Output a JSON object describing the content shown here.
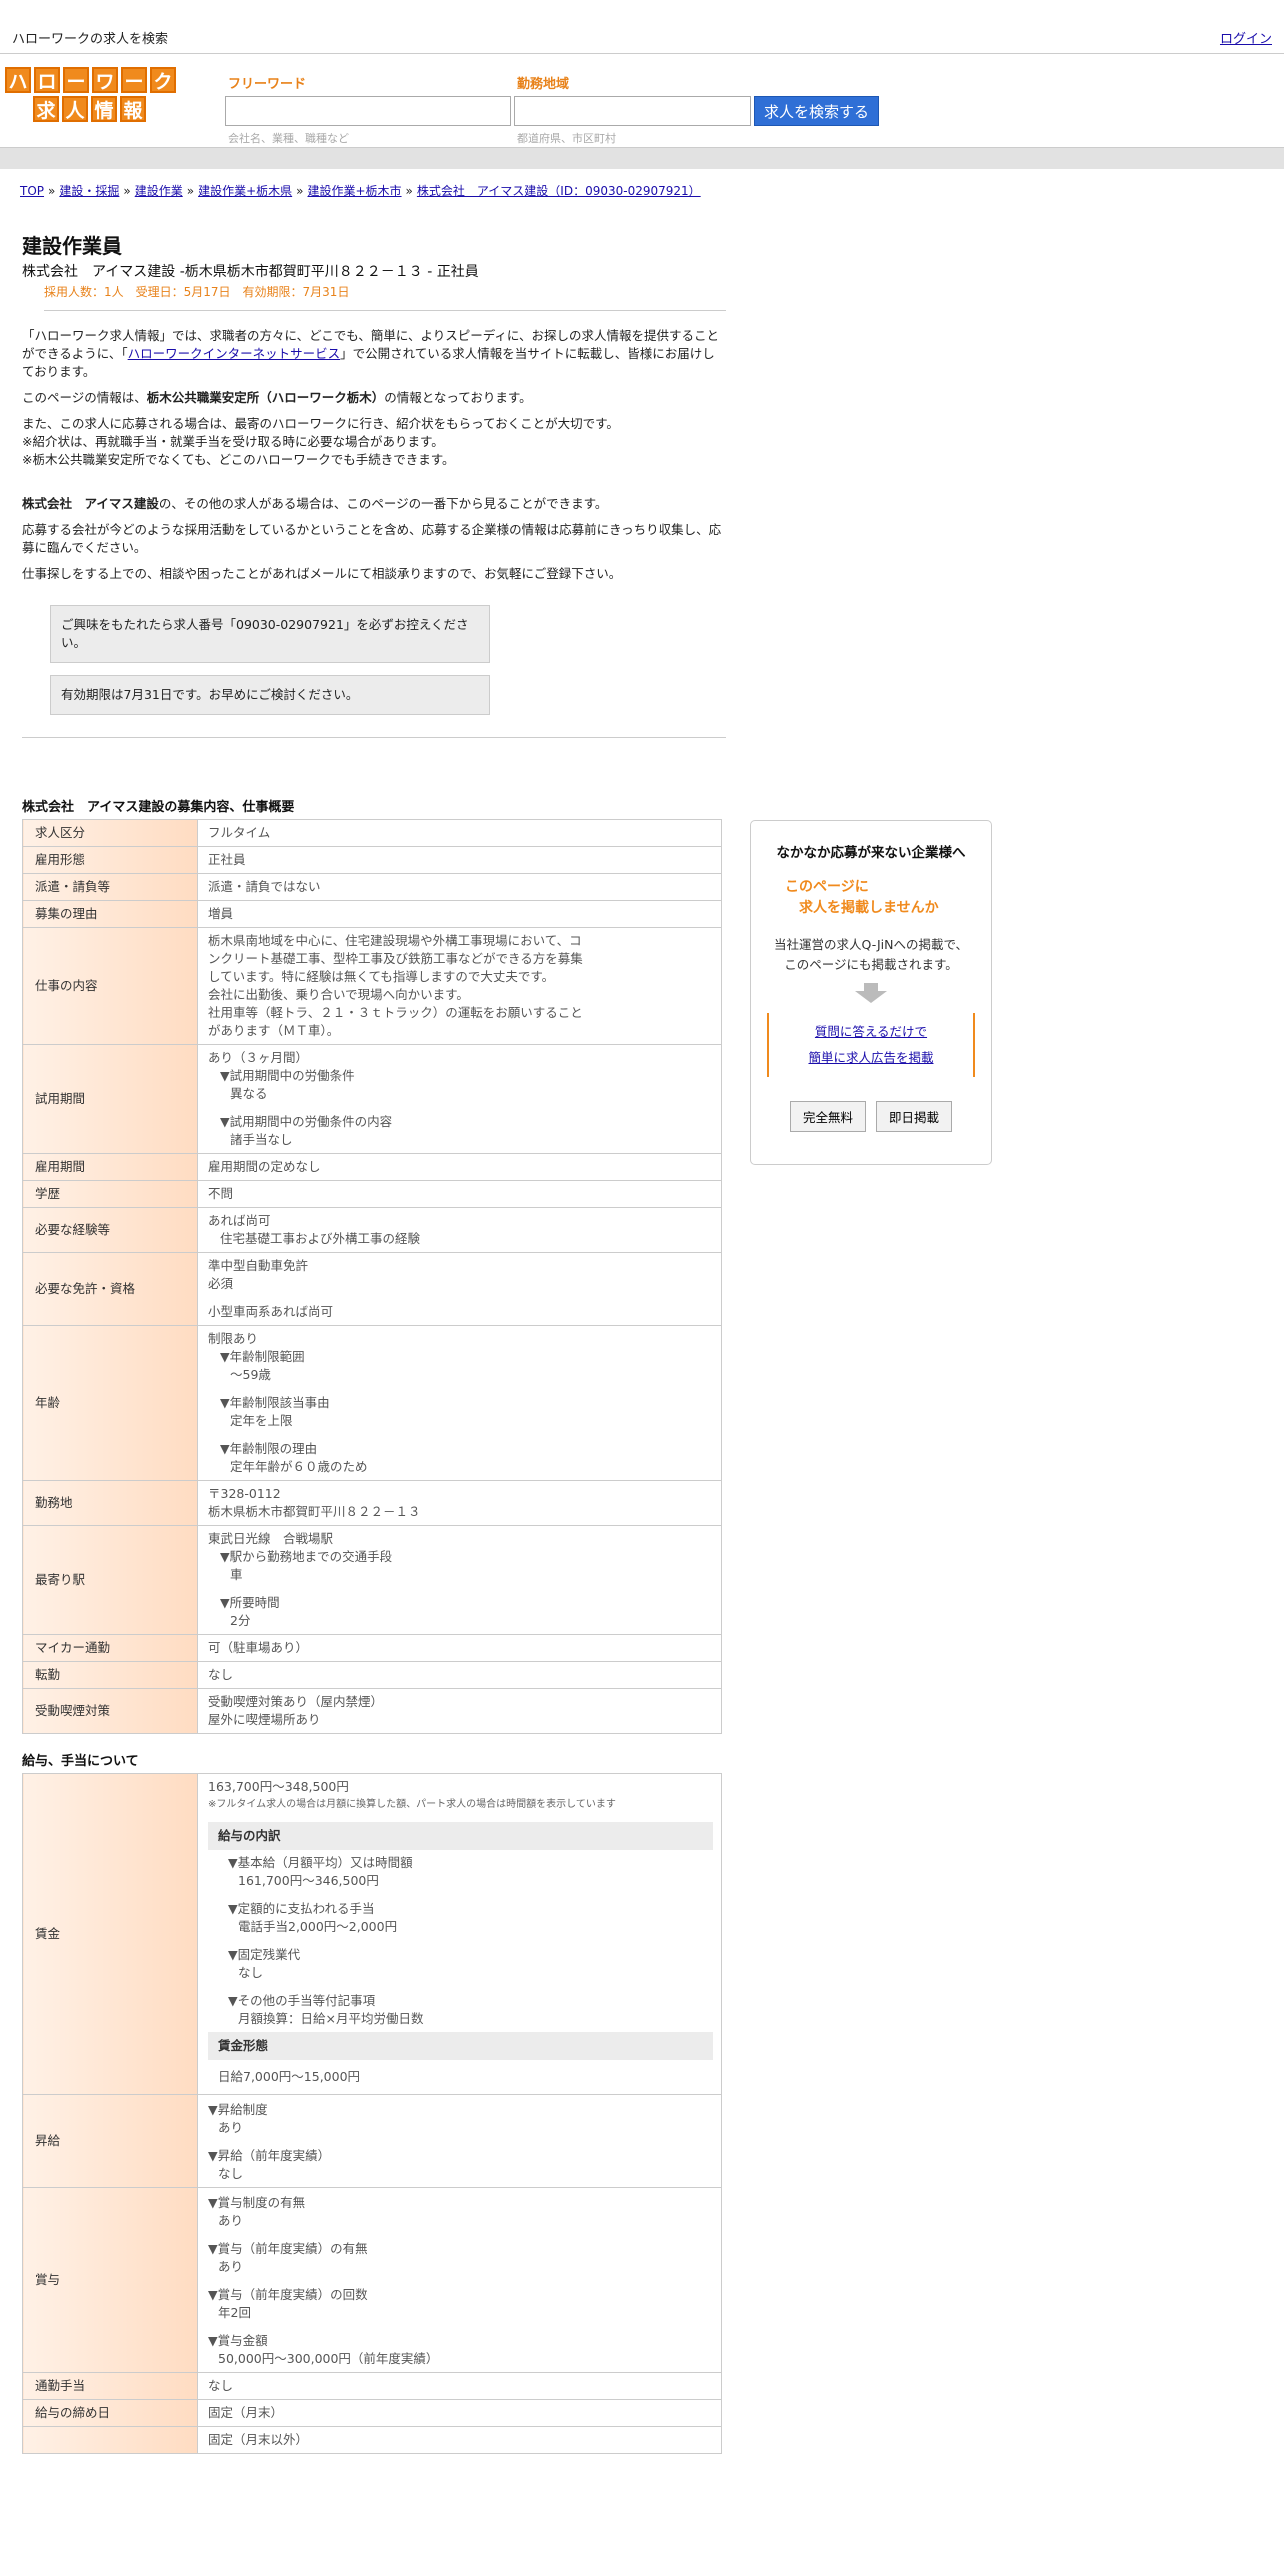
{
  "topbar": {
    "title": "ハローワークの求人を検索",
    "login": "ログイン"
  },
  "logo": {
    "row1": [
      "ハ",
      "ロ",
      "ー",
      "ワ",
      "ー",
      "ク"
    ],
    "row2": [
      "求",
      "人",
      "情",
      "報"
    ]
  },
  "search": {
    "freeword_label": "フリーワード",
    "freeword_hint": "会社名、業種、職種など",
    "area_label": "勤務地域",
    "area_hint": "都道府県、市区町村",
    "button": "求人を検索する"
  },
  "breadcrumb": [
    "TOP",
    "建設・採掘",
    "建設作業",
    "建設作業+栃木県",
    "建設作業+栃木市",
    "株式会社　アイマス建設（ID：09030-02907921）"
  ],
  "job": {
    "title": "建設作業員",
    "company_line": "株式会社　アイマス建設 -栃木県栃木市都賀町平川８２２－１３ - 正社員",
    "recruit_info": "採用人数：1人　受理日：5月17日　有効期限：7月31日"
  },
  "intro": {
    "p1_a": "「ハローワーク求人情報」では、求職者の方々に、どこでも、簡単に、よりスピーディに、お探しの求人情報を提供することができるように、「",
    "p1_link": "ハローワークインターネットサービス",
    "p1_b": "」で公開されている求人情報を当サイトに転載し、皆様にお届けしております。",
    "p2_a": "このページの情報は、",
    "p2_bold": "栃木公共職業安定所（ハローワーク栃木）",
    "p2_b": "の情報となっております。",
    "p3_1": "また、この求人に応募される場合は、最寄のハローワークに行き、紹介状をもらっておくことが大切です。",
    "p3_2": "※紹介状は、再就職手当・就業手当を受け取る時に必要な場合があります。",
    "p3_3": "※栃木公共職業安定所でなくても、どこのハローワークでも手続きできます。",
    "p4_bold": "株式会社　アイマス建設",
    "p4_b": "の、その他の求人がある場合は、このページの一番下から見ることができます。",
    "p5": "応募する会社が今どのような採用活動をしているかということを含め、応募する企業様の情報は応募前にきっちり収集し、応募に臨んでください。",
    "p6": "仕事探しをする上での、相談や困ったことがあればメールにて相談承りますので、お気軽にご登録下さい。",
    "notice1": "ご興味をもたれたら求人番号「09030-02907921」を必ずお控えください。",
    "notice2": "有効期限は7月31日です。お早めにご検討ください。"
  },
  "overview": {
    "title": "株式会社　アイマス建設の募集内容、仕事概要",
    "rows": [
      {
        "k": "求人区分",
        "v": [
          "フルタイム"
        ]
      },
      {
        "k": "雇用形態",
        "v": [
          "正社員"
        ]
      },
      {
        "k": "派遣・請負等",
        "v": [
          "派遣・請負ではない"
        ]
      },
      {
        "k": "募集の理由",
        "v": [
          "増員"
        ]
      },
      {
        "k": "仕事の内容",
        "v": [
          "栃木県南地域を中心に、住宅建設現場や外構工事現場において、コ",
          "ンクリート基礎工事、型枠工事及び鉄筋工事などができる方を募集",
          "しています。特に経験は無くても指導しますので大丈夫です。",
          "会社に出勤後、乗り合いで現場へ向かいます。",
          "社用車等（軽トラ、２１・３ｔトラック）の運転をお願いすること",
          "があります（ＭＴ車）。"
        ]
      },
      {
        "k": "試用期間",
        "v": [
          "あり（３ヶ月間）",
          "▼試用期間中の労働条件",
          "異なる",
          "",
          "▼試用期間中の労働条件の内容",
          "諸手当なし"
        ]
      },
      {
        "k": "雇用期間",
        "v": [
          "雇用期間の定めなし"
        ]
      },
      {
        "k": "学歴",
        "v": [
          "不問"
        ]
      },
      {
        "k": "必要な経験等",
        "v": [
          "あれば尚可",
          "住宅基礎工事および外構工事の経験"
        ]
      },
      {
        "k": "必要な免許・資格",
        "v": [
          "準中型自動車免許",
          "必須",
          "",
          "小型車両系あれば尚可"
        ]
      },
      {
        "k": "年齢",
        "v": [
          "制限あり",
          "▼年齢制限範囲",
          "〜59歳",
          "",
          "▼年齢制限該当事由",
          "定年を上限",
          "",
          "▼年齢制限の理由",
          "定年年齢が６０歳のため"
        ]
      },
      {
        "k": "勤務地",
        "v": [
          "〒328-0112",
          "栃木県栃木市都賀町平川８２２－１３"
        ]
      },
      {
        "k": "最寄り駅",
        "v": [
          "東武日光線　合戦場駅",
          "▼駅から勤務地までの交通手段",
          "車",
          "",
          "▼所要時間",
          "2分"
        ]
      },
      {
        "k": "マイカー通勤",
        "v": [
          "可（駐車場あり）"
        ]
      },
      {
        "k": "転勤",
        "v": [
          "なし"
        ]
      },
      {
        "k": "受動喫煙対策",
        "v": [
          "受動喫煙対策あり（屋内禁煙）",
          "屋外に喫煙場所あり"
        ]
      }
    ]
  },
  "salary": {
    "title": "給与、手当について",
    "wage_label": "賃金",
    "wage_range": "163,700円〜348,500円",
    "wage_note": "※フルタイム求人の場合は月額に換算した額、パート求人の場合は時間額を表示しています",
    "breakdown_head": "給与の内訳",
    "breakdown": [
      {
        "t": "▼基本給（月額平均）又は時間額",
        "v": "161,700円〜346,500円"
      },
      {
        "t": "▼定額的に支払われる手当",
        "v": "電話手当2,000円〜2,000円"
      },
      {
        "t": "▼固定残業代",
        "v": "なし"
      },
      {
        "t": "▼その他の手当等付記事項",
        "v": "月額換算：日給×月平均労働日数"
      }
    ],
    "form_head": "賃金形態",
    "form_value": "日給7,000円〜15,000円",
    "raise_label": "昇給",
    "raise": [
      {
        "t": "▼昇給制度",
        "v": "あり"
      },
      {
        "t": "▼昇給（前年度実績）",
        "v": "なし"
      }
    ],
    "bonus_label": "賞与",
    "bonus": [
      {
        "t": "▼賞与制度の有無",
        "v": "あり"
      },
      {
        "t": "▼賞与（前年度実績）の有無",
        "v": "あり"
      },
      {
        "t": "▼賞与（前年度実績）の回数",
        "v": "年2回"
      },
      {
        "t": "▼賞与金額",
        "v": "50,000円〜300,000円（前年度実績）"
      }
    ],
    "commute_label": "通勤手当",
    "commute_value": "なし",
    "cutoff_label": "給与の締め日",
    "cutoff_value": "固定（月末）",
    "payday_value": "固定（月末以外）"
  },
  "side": {
    "t1": "なかなか応募が来ない企業様へ",
    "t2a": "このページに",
    "t2b": "求人を掲載しませんか",
    "t3a": "当社運営の求人Q-JiNへの掲載で、",
    "t3b": "このページにも掲載されます。",
    "link1": "質問に答えるだけで",
    "link2": "簡単に求人広告を掲載",
    "btn1": "完全無料",
    "btn2": "即日掲載"
  }
}
